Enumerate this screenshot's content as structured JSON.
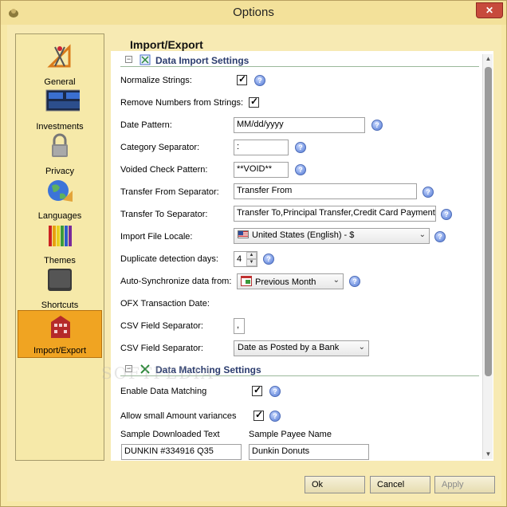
{
  "window": {
    "title": "Options",
    "close_glyph": "✕"
  },
  "sidebar": {
    "items": [
      {
        "label": "General",
        "icon": "compass-ruler-icon"
      },
      {
        "label": "Investments",
        "icon": "stock-monitor-icon"
      },
      {
        "label": "Privacy",
        "icon": "padlock-icon"
      },
      {
        "label": "Languages",
        "icon": "globe-icon"
      },
      {
        "label": "Themes",
        "icon": "crayons-icon"
      },
      {
        "label": "Shortcuts",
        "icon": "ctrl-key-icon"
      },
      {
        "label": "Import/Export",
        "icon": "building-icon",
        "active": true
      }
    ]
  },
  "content": {
    "title": "Import/Export"
  },
  "import_settings": {
    "section_label": "Data Import Settings",
    "toggle_glyph": "−",
    "normalize_strings": {
      "label": "Normalize Strings:",
      "checked": true
    },
    "remove_numbers": {
      "label": "Remove Numbers from Strings:",
      "checked": true
    },
    "date_pattern": {
      "label": "Date Pattern:",
      "value": "MM/dd/yyyy"
    },
    "category_separator": {
      "label": "Category Separator:",
      "value": ":"
    },
    "voided_check_pattern": {
      "label": "Voided Check Pattern:",
      "value": "**VOID**"
    },
    "transfer_from_separator": {
      "label": "Transfer From Separator:",
      "value": "Transfer From"
    },
    "transfer_to_separator": {
      "label": "Transfer To Separator:",
      "value": "Transfer To,Principal Transfer,Credit Card Payment"
    },
    "import_file_locale": {
      "label": "Import File Locale:",
      "value": "United States (English) - $"
    },
    "duplicate_detection_days": {
      "label": "Duplicate detection days:",
      "value": "4"
    },
    "auto_sync": {
      "label": "Auto-Synchronize data from:",
      "value": "Previous Month"
    },
    "ofx_transaction_date": {
      "label": "OFX Transaction Date:"
    },
    "csv_field_separator": {
      "label": "CSV Field Separator:",
      "value": ","
    },
    "csv_date_mode": {
      "label": "CSV Field Separator:",
      "value": "Date as Posted by a Bank"
    }
  },
  "matching_settings": {
    "section_label": "Data Matching Settings",
    "toggle_glyph": "−",
    "enable_matching": {
      "label": "Enable Data Matching",
      "checked": true
    },
    "allow_small_variances": {
      "label": "Allow small Amount variances",
      "checked": true
    },
    "sample_downloaded_text": {
      "label": "Sample Downloaded Text",
      "value": "DUNKIN #334916     Q35"
    },
    "sample_payee_name": {
      "label": "Sample Payee Name",
      "value": "Dunkin Donuts"
    }
  },
  "glyphs": {
    "check": "✓",
    "help": "?",
    "dropdown": "⌄",
    "up": "▲",
    "down": "▼"
  },
  "buttons": {
    "ok": "Ok",
    "cancel": "Cancel",
    "apply": "Apply"
  },
  "watermark": "SOFTPEDIA",
  "colors": {
    "window_bg": "#f7e8a6",
    "active_item": "#f0a422",
    "section_text": "#2b3c6e"
  }
}
